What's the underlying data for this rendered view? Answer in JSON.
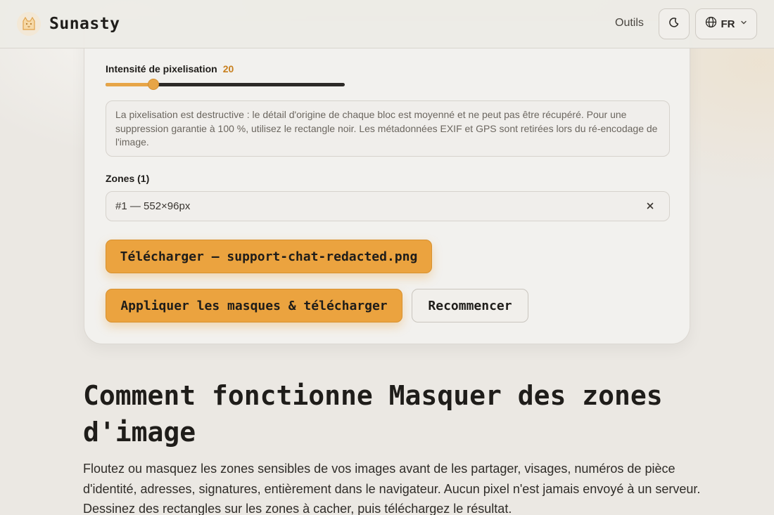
{
  "header": {
    "brand": "Sunasty",
    "nav_tools": "Outils",
    "lang": "FR",
    "icons": [
      "cat-logo-icon",
      "moon-icon",
      "globe-icon",
      "chevron-down-icon"
    ]
  },
  "tool": {
    "pixelation_label": "Intensité de pixelisation",
    "pixelation_value": "20",
    "pixelation_fraction": 0.2,
    "notice": "La pixelisation est destructive : le détail d'origine de chaque bloc est moyenné et ne peut pas être récupéré. Pour une suppression garantie à 100 %, utilisez le rectangle noir. Les métadonnées EXIF et GPS sont retirées lors du ré-encodage de l'image.",
    "zones_label": "Zones (1)",
    "zones": [
      {
        "label": "#1 — 552×96px"
      }
    ],
    "download_button": "Télécharger — support-chat-redacted.png",
    "apply_button": "Appliquer les masques & télécharger",
    "restart_button": "Recommencer"
  },
  "info": {
    "title": "Comment fonctionne Masquer des zones d'image",
    "body": "Floutez ou masquez les zones sensibles de vos images avant de les partager, visages, numéros de pièce d'identité, adresses, signatures, entièrement dans le navigateur. Aucun pixel n'est jamais envoyé à un serveur. Dessinez des rectangles sur les zones à cacher, puis téléchargez le résultat."
  },
  "colors": {
    "accent": "#eba33f",
    "background": "#ebe8e3",
    "card": "#f2f1ee"
  }
}
